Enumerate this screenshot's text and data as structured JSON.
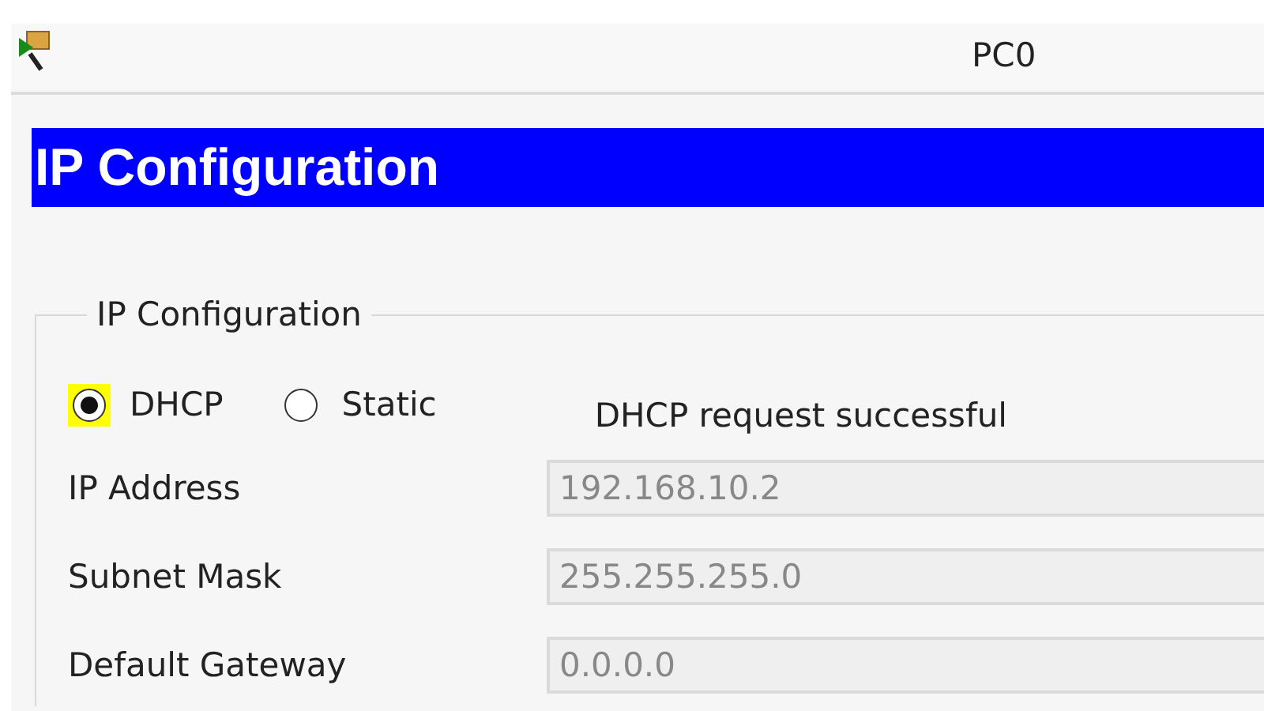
{
  "window": {
    "title": "PC0"
  },
  "header": {
    "title": "IP Configuration"
  },
  "group": {
    "legend": "IP Configuration",
    "modes": [
      {
        "label": "DHCP",
        "selected": true
      },
      {
        "label": "Static",
        "selected": false
      }
    ],
    "status": "DHCP request successful",
    "fields": [
      {
        "label": "IP Address",
        "value": "192.168.10.2",
        "disabled": true
      },
      {
        "label": "Subnet Mask",
        "value": "255.255.255.0",
        "disabled": true
      },
      {
        "label": "Default Gateway",
        "value": "0.0.0.0",
        "disabled": true
      }
    ]
  }
}
